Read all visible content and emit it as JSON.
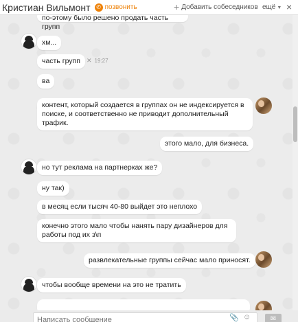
{
  "header": {
    "name": "Кристиан Вильмонт",
    "call_label": "позвонить",
    "add_label": "Добавить собеседников",
    "more_label": "ещё"
  },
  "messages": [
    {
      "text": "по-этому было решено продать часть групп"
    },
    {
      "text": "хм..."
    },
    {
      "text": "часть групп"
    },
    {
      "text": "ва"
    },
    {
      "text": "контент, который создается в группах он не индексируется в поиске, и соответственно не приводит дополнительный трафик."
    },
    {
      "text": "этого мало, для бизнеса."
    },
    {
      "text": "но тут реклама на партнерках же?"
    },
    {
      "text": "ну так)"
    },
    {
      "text": "в месяц если тысяч 40-80 выйдет это неплохо"
    },
    {
      "text": "конечно этого мало чтобы нанять пару дизайнеров для работы под их з\\п"
    },
    {
      "text": "развлекательные группы сейчас мало приносят."
    },
    {
      "text": "чтобы вообще времени на это не тратить"
    }
  ],
  "meta": {
    "time": "19:27"
  },
  "composer": {
    "placeholder": "Написать сообщение"
  }
}
